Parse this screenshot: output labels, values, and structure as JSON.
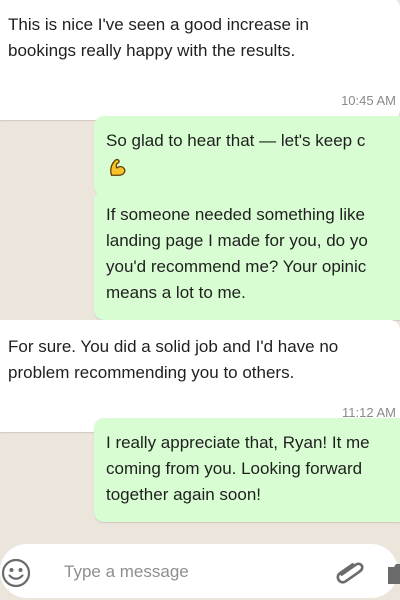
{
  "messages": [
    {
      "direction": "incoming",
      "text": "This is nice I've seen a good increase in\nbookings really happy with the results.",
      "time": "10:45 AM"
    },
    {
      "direction": "outgoing",
      "text": "So glad to hear that — let's keep c",
      "emoji": "flexed-biceps-icon"
    },
    {
      "direction": "outgoing",
      "text": "If someone needed something like\nlanding page I made for you, do yo\nyou'd recommend me? Your opinic\nmeans a lot to me."
    },
    {
      "direction": "incoming",
      "text": "For sure. You did a solid job and I'd have no\nproblem recommending you to others.",
      "time": "11:12 AM"
    },
    {
      "direction": "outgoing",
      "text": "I really appreciate that, Ryan! It me\ncoming from you. Looking forward\ntogether again soon!"
    }
  ],
  "composer": {
    "placeholder": "Type a message",
    "icons": [
      "emoji-icon",
      "paperclip-icon",
      "camera-icon"
    ]
  },
  "colors": {
    "background": "#ece5dc",
    "incoming_bubble": "#ffffff",
    "outgoing_bubble": "#d9fdd3",
    "timestamp": "#8a8a8a",
    "emoji_fill": "#f7c22b"
  }
}
